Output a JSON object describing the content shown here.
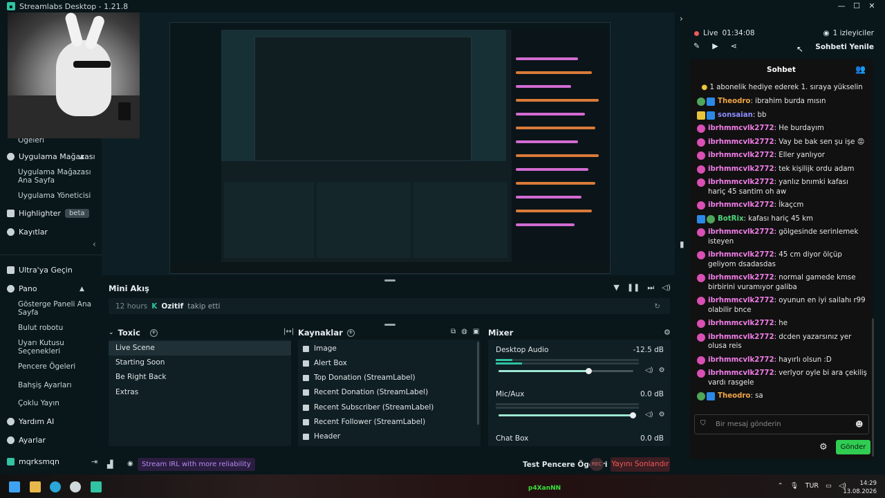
{
  "window": {
    "title": "Streamlabs Desktop - 1.21.8",
    "controls": [
      "—",
      "☐",
      "✕"
    ]
  },
  "sidebar": {
    "items": [
      {
        "label": "Ögeleri"
      },
      {
        "label": "Uygulama Mağazası"
      },
      {
        "label": "Uygulama Mağazası Ana Sayfa"
      },
      {
        "label": "Uygulama Yöneticisi"
      },
      {
        "label": "Highlighter",
        "badge": "beta"
      },
      {
        "label": "Kayıtlar"
      },
      {
        "label": "Ultra'ya Geçin"
      },
      {
        "label": "Pano"
      },
      {
        "label": "Gösterge Paneli Ana Sayfa"
      },
      {
        "label": "Bulut robotu"
      },
      {
        "label": "Uyarı Kutusu Seçenekleri"
      },
      {
        "label": "Pencere Ögeleri"
      },
      {
        "label": "Bahşiş Ayarları"
      },
      {
        "label": "Çoklu Yayın"
      },
      {
        "label": "Yardım AI"
      },
      {
        "label": "Ayarlar"
      },
      {
        "label": "mqrksmqn"
      }
    ]
  },
  "mini_feed": {
    "title": "Mini Akış",
    "event": {
      "time": "12 hours",
      "user": "Ozitif",
      "action": "takip etti"
    }
  },
  "scenes": {
    "title": "Toxic",
    "items": [
      "Live Scene",
      "Starting Soon",
      "Be Right Back",
      "Extras"
    ],
    "active": "Live Scene"
  },
  "sources": {
    "title": "Kaynaklar",
    "items": [
      "Image",
      "Alert Box",
      "Top Donation (StreamLabel)",
      "Recent Donation (StreamLabel)",
      "Recent Subscriber (StreamLabel)",
      "Recent Follower (StreamLabel)",
      "Header"
    ]
  },
  "mixer": {
    "title": "Mixer",
    "channels": [
      {
        "name": "Desktop Audio",
        "db": "-12.5 dB",
        "volume": 0.67
      },
      {
        "name": "Mic/Aux",
        "db": "0.0 dB",
        "volume": 1.0
      },
      {
        "name": "Chat Box",
        "db": "0.0 dB"
      }
    ]
  },
  "status": {
    "irl": "Stream IRL with more reliability",
    "test_widgets": "Test Pencere Ögeleri",
    "rec": "REC",
    "end_stream": "Yayını Sonlandır"
  },
  "stream": {
    "live_label": "Live",
    "live_time": "01:34:08",
    "viewers": "1 izleyiciler",
    "refresh_chat": "Sohbeti Yenile"
  },
  "chat": {
    "title": "Sohbet",
    "notice": "1 abonelik hediye ederek 1. sıraya yükselin",
    "messages": [
      {
        "user": "Theodro",
        "text": "ibrahim burda mısın",
        "color": "orange"
      },
      {
        "user": "sonsaian",
        "text": "bb",
        "color": "blue",
        "badge": "12"
      },
      {
        "user": "ibrhmmcvlk2772",
        "text": "He burdayım",
        "color": "pink"
      },
      {
        "user": "ibrhmmcvlk2772",
        "text": "Vay be bak sen şu işe 😡",
        "color": "pink"
      },
      {
        "user": "ibrhmmcvlk2772",
        "text": "Eller yanlıyor",
        "color": "pink"
      },
      {
        "user": "ibrhmmcvlk2772",
        "text": "tek kişilijk ordu adam",
        "color": "pink"
      },
      {
        "user": "ibrhmmcvlk2772",
        "text": "yanlız bnımki kafası hariç 45 santim oh aw",
        "color": "pink"
      },
      {
        "user": "ibrhmmcvlk2772",
        "text": "İkaçcm",
        "color": "pink"
      },
      {
        "user": "BotRix",
        "text": "kafası hariç 45 km",
        "color": "green"
      },
      {
        "user": "ibrhmmcvlk2772",
        "text": "gölgesinde serinlemek isteyen",
        "color": "pink"
      },
      {
        "user": "ibrhmmcvlk2772",
        "text": "45 cm diyor ölçüp geliyom dsadasdas",
        "color": "pink"
      },
      {
        "user": "ibrhmmcvlk2772",
        "text": "normal gamede kmse birbirini vuramıyor galiba",
        "color": "pink"
      },
      {
        "user": "ibrhmmcvlk2772",
        "text": "oyunun en iyi sailahı r99 olabilir bnce",
        "color": "pink"
      },
      {
        "user": "ibrhmmcvlk2772",
        "text": "he",
        "color": "pink"
      },
      {
        "user": "ibrhmmcvlk2772",
        "text": "dcden yazarsınız yer olusa reis",
        "color": "pink"
      },
      {
        "user": "ibrhmmcvlk2772",
        "text": "hayırlı olsun :D",
        "color": "pink"
      },
      {
        "user": "ibrhmmcvlk2772",
        "text": "verlyor oyle bi ara çekiliş vardı rasgele",
        "color": "pink"
      },
      {
        "user": "Theodro",
        "text": "sa",
        "color": "orange"
      }
    ],
    "input_placeholder": "Bir mesaj gönderin",
    "send_label": "Gönder"
  },
  "taskbar": {
    "center_label": "p4XanNN",
    "lang": "TUR",
    "time": "14:29",
    "date": "13.08.2026"
  },
  "colors": {
    "accent": "#31c3a2",
    "bg": "#09161a",
    "danger": "#ef5a5a",
    "chat_send": "#2fcd52"
  }
}
